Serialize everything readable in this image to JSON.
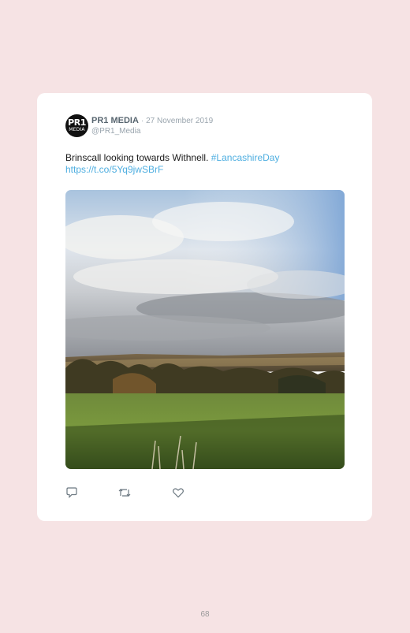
{
  "tweet": {
    "author_name": "PR1 MEDIA",
    "date": "· 27 November 2019",
    "handle": "@PR1_Media",
    "avatar_top": "PR1",
    "avatar_bottom": "MEDIA",
    "text": "Brinscall looking towards Withnell.",
    "hashtag": "#LancashireDay",
    "link": "https://t.co/5Yq9jwSBrF",
    "photo_icon": "landscape-photo",
    "actions": [
      "reply-icon",
      "retweet-icon",
      "like-icon"
    ]
  },
  "page": {
    "number": "68"
  },
  "colors": {
    "background": "#f6e3e4",
    "card": "#ffffff",
    "link": "#4eaee0",
    "muted": "#9aa5ae"
  }
}
